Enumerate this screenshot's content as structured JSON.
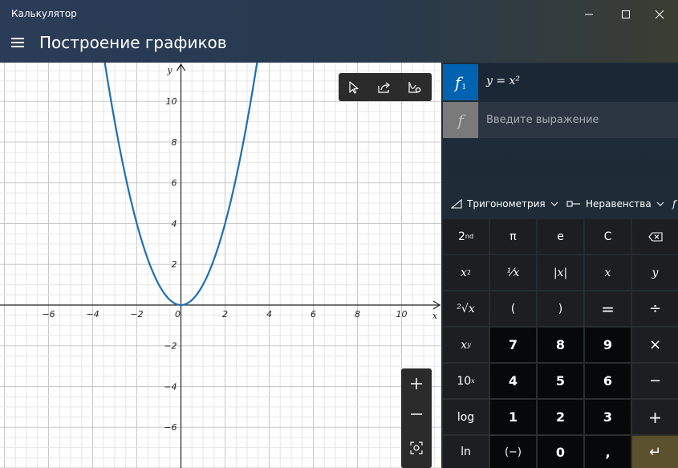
{
  "window": {
    "title": "Калькулятор"
  },
  "header": {
    "title": "Построение графиков"
  },
  "graph": {
    "x_ticks": [
      "−6",
      "−4",
      "−2",
      "0",
      "2",
      "4",
      "6",
      "8",
      "10"
    ],
    "y_ticks": [
      "10",
      "8",
      "6",
      "4",
      "2",
      "−2",
      "−4",
      "−6"
    ],
    "x_label": "x",
    "y_label": "y",
    "x_range": [
      -8.2,
      11.8
    ],
    "y_range": [
      -8,
      11.9
    ],
    "function": "x^2",
    "curve_color": "#1f6fb2"
  },
  "expressions": {
    "items": [
      {
        "badge": "f",
        "index": "1",
        "text": "y = x²",
        "color": "#0063b1"
      }
    ],
    "new_badge": "f",
    "placeholder": "Введите выражение"
  },
  "functions_bar": {
    "trig_label": "Тригонометрия",
    "ineq_label": "Неравенства",
    "more_label": "f"
  },
  "keypad": {
    "second": "2",
    "second_sup": "nd",
    "pi": "π",
    "e": "e",
    "clear": "C",
    "square_base": "x",
    "square_exp": "2",
    "reciprocal": "¹⁄x",
    "abs": "|x|",
    "var_x": "x",
    "var_y": "y",
    "sqrt": "²√x",
    "open_paren": "(",
    "close_paren": ")",
    "equals": "=",
    "divide": "÷",
    "power_base": "x",
    "power_exp": "y",
    "seven": "7",
    "eight": "8",
    "nine": "9",
    "multiply": "×",
    "ten_pow_base": "10",
    "ten_pow_exp": "x",
    "four": "4",
    "five": "5",
    "six": "6",
    "minus": "−",
    "log": "log",
    "one": "1",
    "two": "2",
    "three": "3",
    "plus": "+",
    "ln": "ln",
    "negate": "(−)",
    "zero": "0",
    "decimal": ",",
    "enter": "↵"
  }
}
